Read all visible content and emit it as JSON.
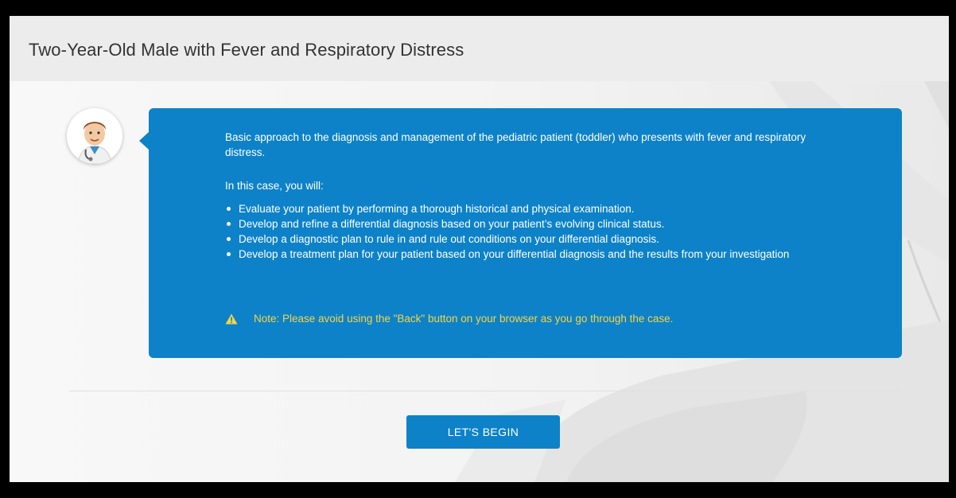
{
  "page": {
    "title": "Two-Year-Old Male with Fever and Respiratory Distress"
  },
  "intro": {
    "avatar_icon": "doctor-avatar-icon",
    "description": "Basic approach to the diagnosis and management of the pediatric patient (toddler) who presents with fever and respiratory distress.",
    "objectives_heading": "In this case, you will:",
    "objectives": [
      "Evaluate your patient by performing a thorough historical and physical examination.",
      "Develop and refine a differential diagnosis based on your patient’s evolving clinical status.",
      "Develop a diagnostic plan to rule in and rule out conditions on your differential diagnosis.",
      "Develop a treatment plan for your patient based on your differential diagnosis and the results from your investigation"
    ],
    "note": "Note: Please avoid using the \"Back\" button on your browser as you go through the case.",
    "note_icon": "warning-icon"
  },
  "actions": {
    "begin_label": "LET'S BEGIN"
  },
  "colors": {
    "accent": "#0d82c8",
    "note_text": "#f2d44a",
    "header_bg": "#ececec",
    "frame": "#000000"
  }
}
